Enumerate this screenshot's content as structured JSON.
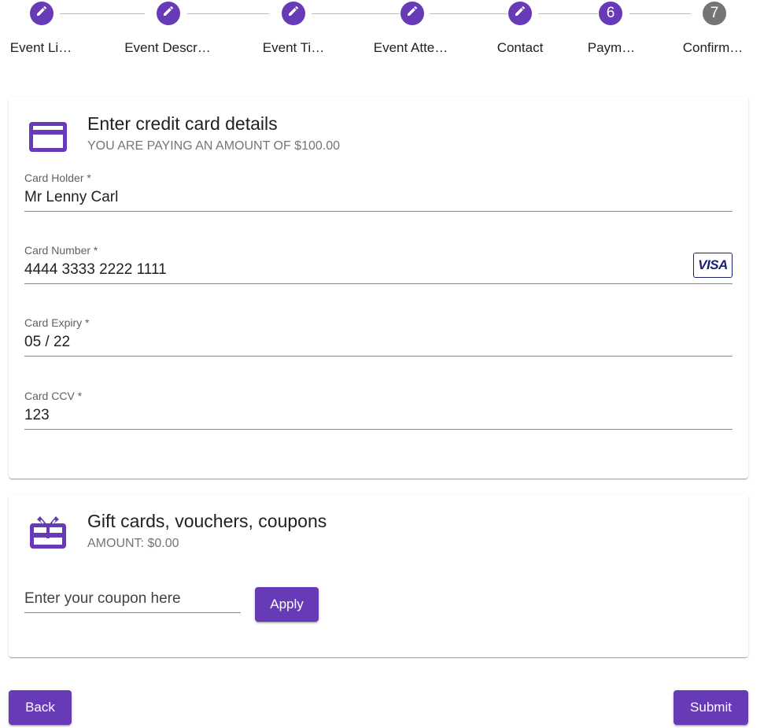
{
  "stepper": {
    "steps": [
      {
        "label": "Event Li…",
        "state": "done",
        "icon": "pencil-icon"
      },
      {
        "label": "Event Descr…",
        "state": "done",
        "icon": "pencil-icon"
      },
      {
        "label": "Event Ti…",
        "state": "done",
        "icon": "pencil-icon"
      },
      {
        "label": "Event Atte…",
        "state": "done",
        "icon": "pencil-icon"
      },
      {
        "label": "Contact",
        "state": "done",
        "icon": "pencil-icon"
      },
      {
        "label": "Paym…",
        "state": "active",
        "number": "6"
      },
      {
        "label": "Confirm…",
        "state": "pending",
        "number": "7"
      }
    ]
  },
  "credit_card": {
    "icon": "credit-card-icon",
    "title": "Enter credit card details",
    "subtitle": "YOU ARE PAYING AN AMOUNT OF $100.00",
    "holder": {
      "label": "Card Holder *",
      "value": "Mr Lenny Carl"
    },
    "number": {
      "label": "Card Number *",
      "value": "4444 3333 2222 1111",
      "brand": "VISA"
    },
    "expiry": {
      "label": "Card Expiry *",
      "value": "05 / 22"
    },
    "ccv": {
      "label": "Card CCV *",
      "value": "123"
    }
  },
  "gift": {
    "icon": "gift-card-icon",
    "title": "Gift cards, vouchers, coupons",
    "subtitle": "AMOUNT: $0.00",
    "coupon_placeholder": "Enter your coupon here",
    "coupon_value": "",
    "apply_label": "Apply"
  },
  "actions": {
    "back_label": "Back",
    "submit_label": "Submit"
  },
  "colors": {
    "accent": "#673ab7",
    "pending": "#757575"
  }
}
